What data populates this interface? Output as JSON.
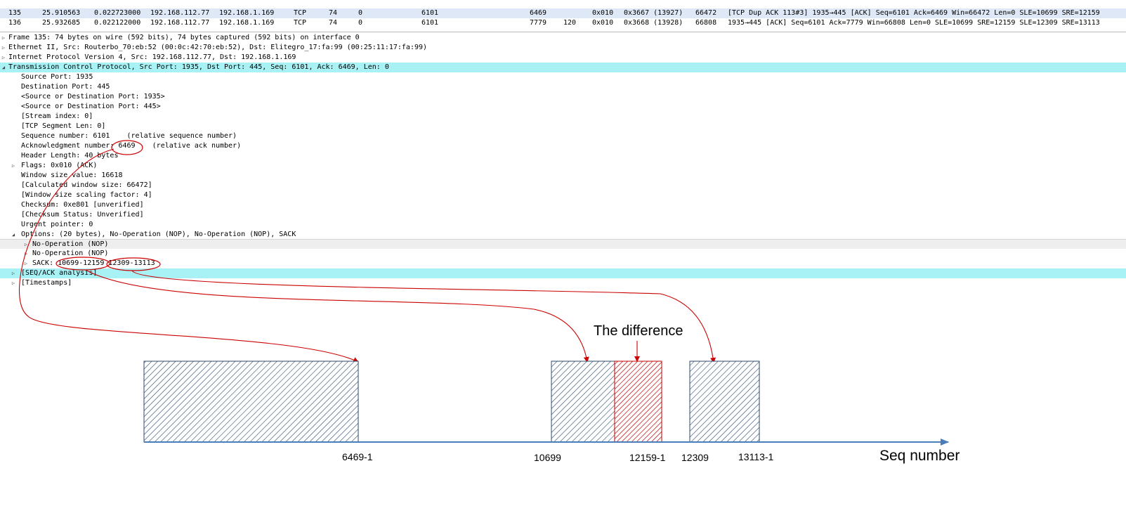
{
  "packets": [
    {
      "no": "135",
      "time": "25.910563",
      "delta": "0.022723000",
      "src": "192.168.112.77",
      "dst": "192.168.1.169",
      "proto": "TCP",
      "len": "74",
      "c1": "0",
      "seq": "6101",
      "ack": "6469",
      "c2": "",
      "flags": "0x010",
      "c3": "0x3667 (13927)",
      "win": "66472",
      "info": "[TCP Dup ACK 113#3] 1935→445 [ACK] Seq=6101 Ack=6469 Win=66472 Len=0 SLE=10699 SRE=12159"
    },
    {
      "no": "136",
      "time": "25.932685",
      "delta": "0.022122000",
      "src": "192.168.112.77",
      "dst": "192.168.1.169",
      "proto": "TCP",
      "len": "74",
      "c1": "0",
      "seq": "6101",
      "ack": "7779",
      "c2": "120",
      "flags": "0x010",
      "c3": "0x3668 (13928)",
      "win": "66808",
      "info": "1935→445 [ACK] Seq=6101 Ack=7779 Win=66808 Len=0 SLE=10699 SRE=12159 SLE=12309 SRE=13113"
    }
  ],
  "details": {
    "frame": "Frame 135: 74 bytes on wire (592 bits), 74 bytes captured (592 bits) on interface 0",
    "ethernet": "Ethernet II, Src: Routerbo_70:eb:52 (00:0c:42:70:eb:52), Dst: Elitegro_17:fa:99 (00:25:11:17:fa:99)",
    "ip": "Internet Protocol Version 4, Src: 192.168.112.77, Dst: 192.168.1.169",
    "tcp": "Transmission Control Protocol, Src Port: 1935, Dst Port: 445, Seq: 6101, Ack: 6469, Len: 0",
    "source_port": "Source Port: 1935",
    "dest_port": "Destination Port: 445",
    "src_or_dst_1": "<Source or Destination Port: 1935>",
    "src_or_dst_2": "<Source or Destination Port: 445>",
    "stream_index": "[Stream index: 0]",
    "segment_len": "[TCP Segment Len: 0]",
    "seq_number": "Sequence number: 6101    (relative sequence number)",
    "ack_prefix": "Acknowledgment number: ",
    "ack_value": "6469",
    "ack_suffix": "    (relative ack number)",
    "header_length": "Header Length: 40 bytes",
    "flags": "Flags: 0x010 (ACK)",
    "window_size": "Window size value: 16618",
    "calc_window": "[Calculated window size: 66472]",
    "scaling": "[Window size scaling factor: 4]",
    "checksum": "Checksum: 0xe801 [unverified]",
    "checksum_status": "[Checksum Status: Unverified]",
    "urgent": "Urgent pointer: 0",
    "options": "Options: (20 bytes), No-Operation (NOP), No-Operation (NOP), SACK",
    "nop1": "No-Operation (NOP)",
    "nop2": "No-Operation (NOP)",
    "sack_prefix": "SACK: ",
    "sack_range1": "10699-12159",
    "sack_range2": "12309-13113",
    "seq_ack_analysis": "[SEQ/ACK analysis]",
    "timestamps": "[Timestamps]"
  },
  "diagram": {
    "caption": "The difference",
    "axis_label": "Seq number",
    "tick_labels": [
      "6469-1",
      "10699",
      "12159-1",
      "12309",
      "13113-1"
    ],
    "colors": {
      "block": "#2c4a6e",
      "difference": "#c00000",
      "arrow": "#cc0000",
      "axis": "#4a7ebb"
    }
  }
}
